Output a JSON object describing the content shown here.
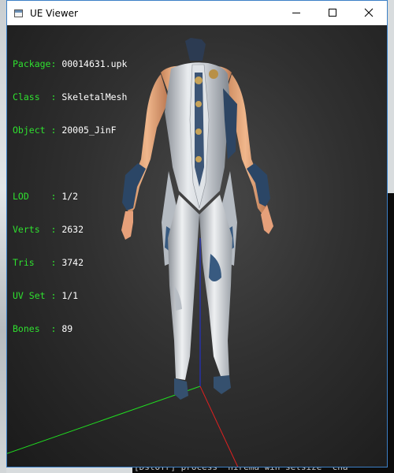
{
  "window": {
    "title": "UE Viewer"
  },
  "controls": {
    "minimize": "minimize",
    "maximize": "maximize",
    "close": "close"
  },
  "info": {
    "package_label": "Package:",
    "package_value": "00014631.upk",
    "class_label": "Class  :",
    "class_value": "SkeletalMesh",
    "object_label": "Object :",
    "object_value": "20005_JinF",
    "lod_label": "LOD    :",
    "lod_value": "1/2",
    "verts_label": "Verts  :",
    "verts_value": "2632",
    "tris_label": "Tris   :",
    "tris_value": "3742",
    "uvset_label": "UV Set :",
    "uvset_value": "1/1",
    "bones_label": "Bones  :",
    "bones_value": "89"
  },
  "background": {
    "console_text": "[DstOTr] process  hirema win setsize  cha"
  },
  "colors": {
    "label_green": "#2fe02f",
    "axis_x": "#e02020",
    "axis_y": "#20e020",
    "axis_z": "#2030e0"
  }
}
